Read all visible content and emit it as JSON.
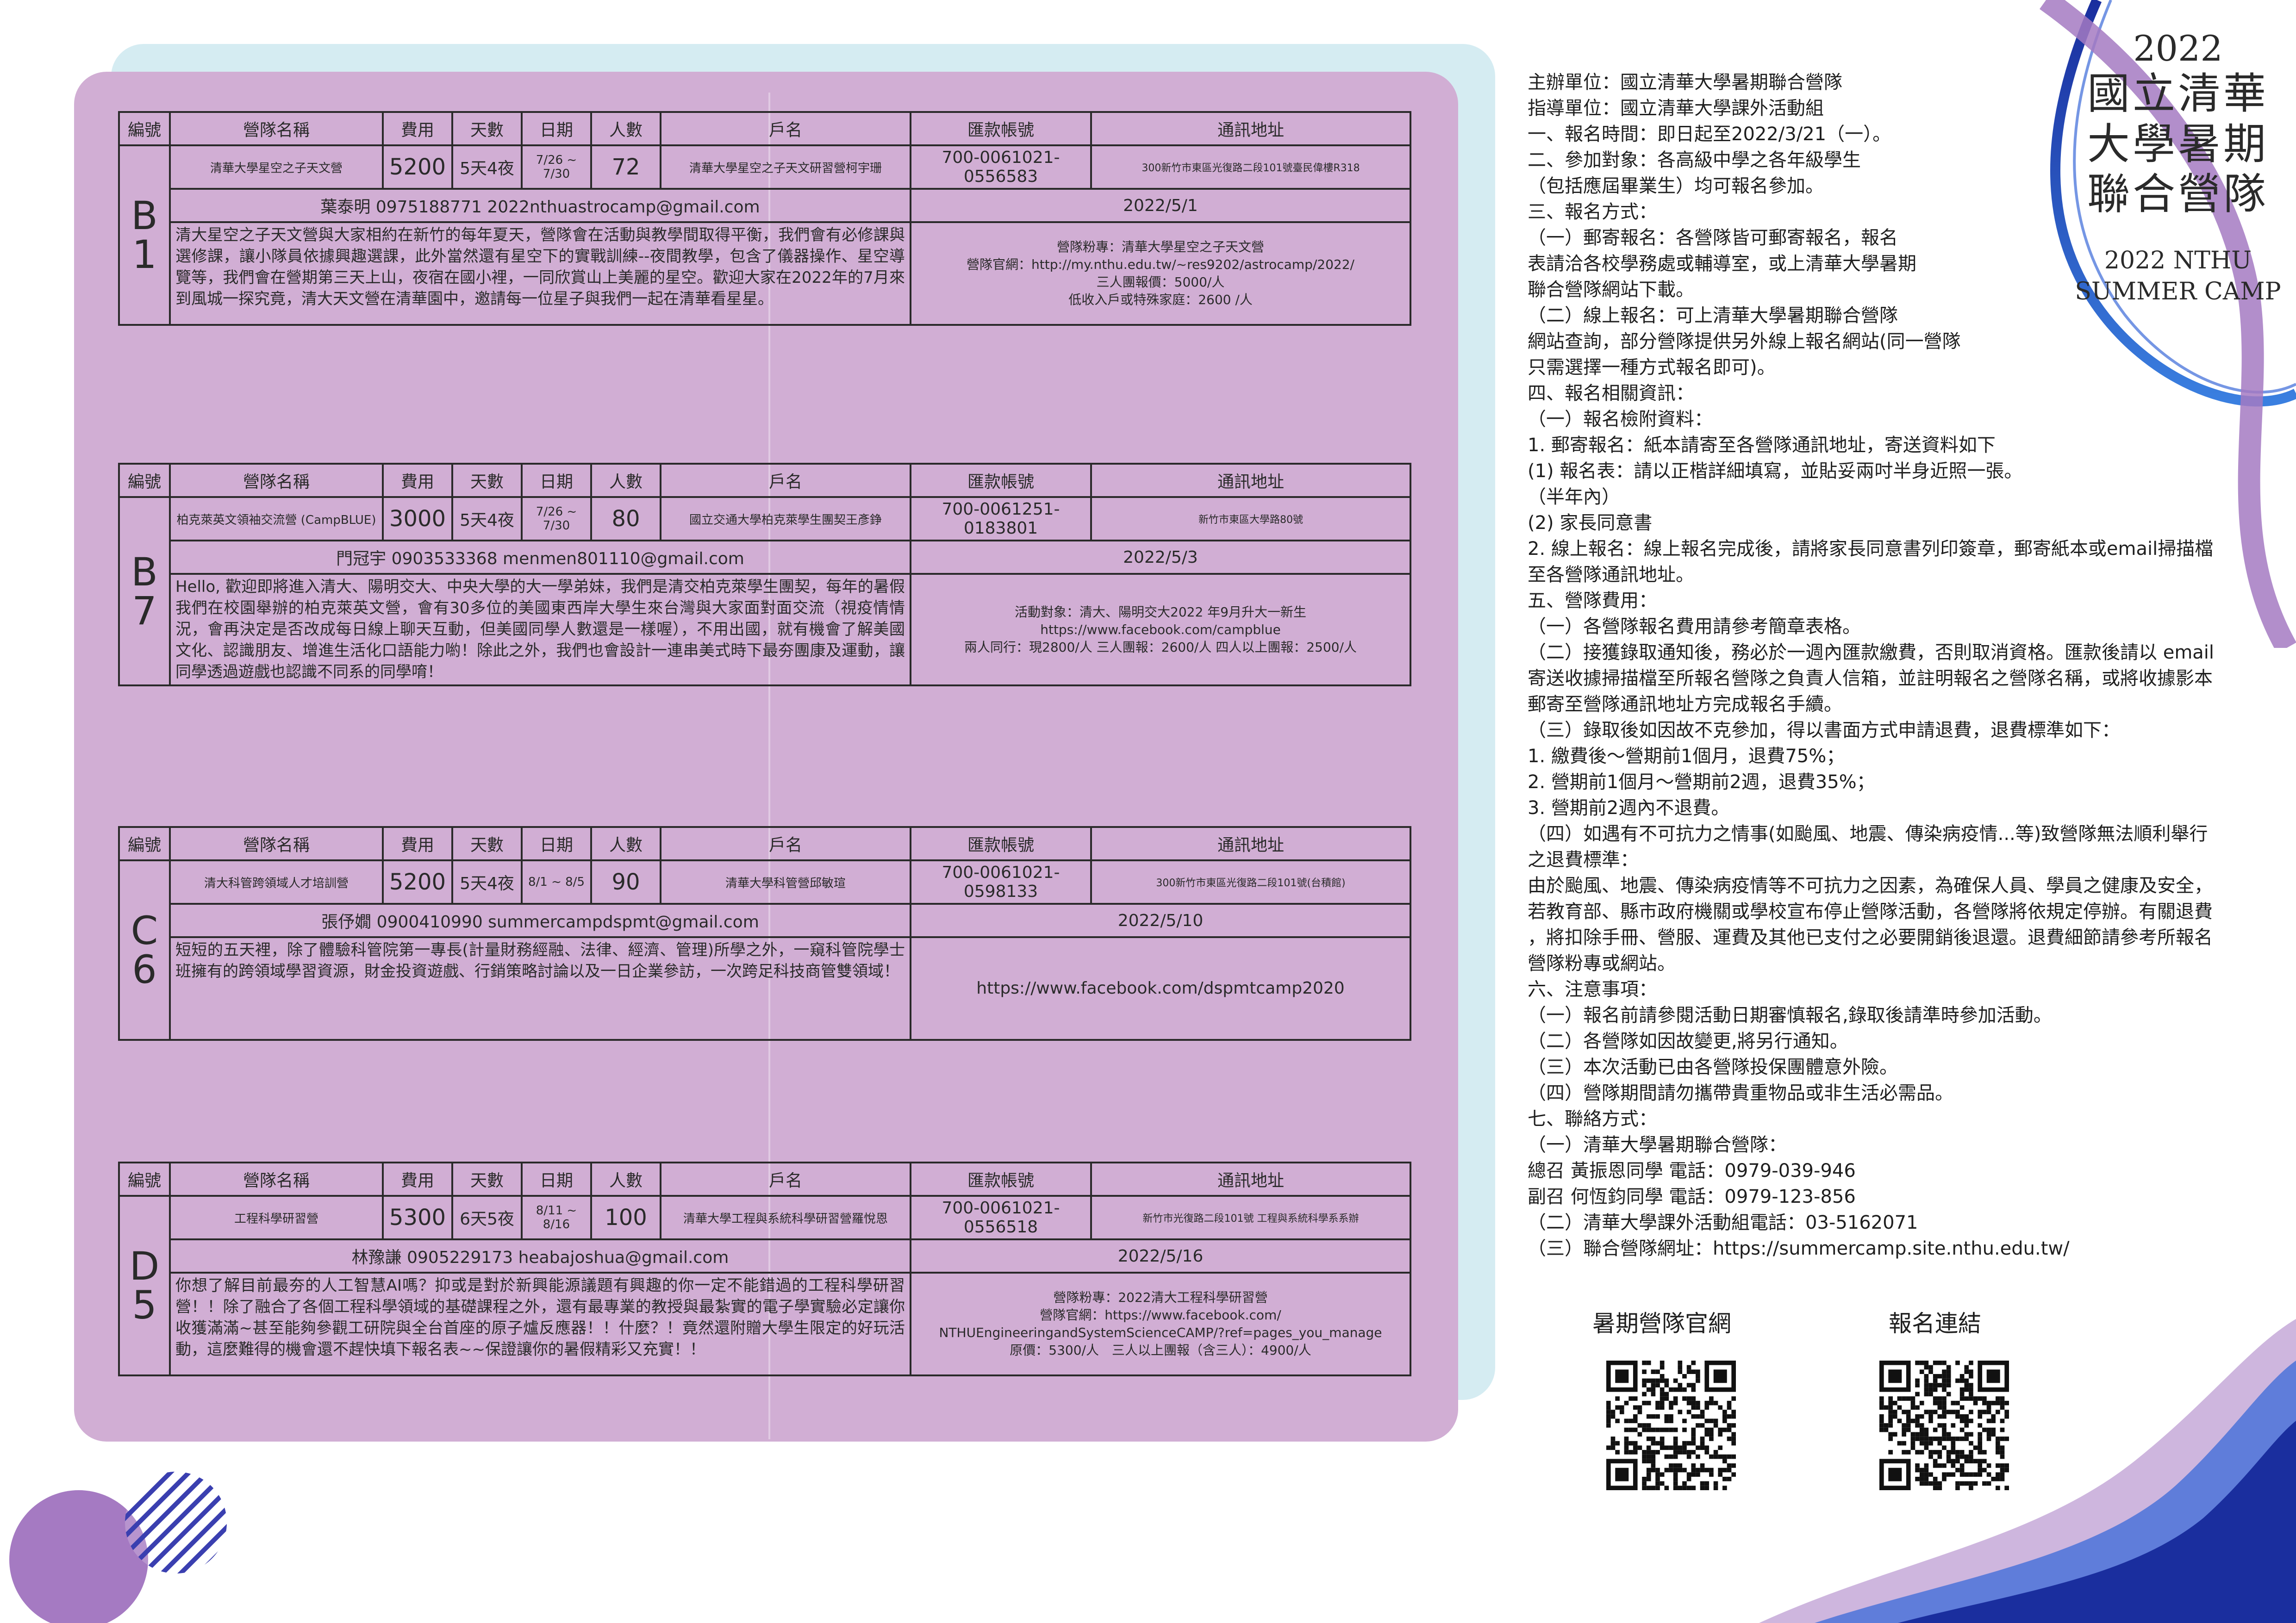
{
  "headers": {
    "id": "編號",
    "name": "營隊名稱",
    "fee": "費用",
    "days": "天數",
    "date": "日期",
    "people": "人數",
    "holder": "戶名",
    "account": "匯款帳號",
    "address": "通訊地址"
  },
  "camps": [
    {
      "id": "B\n1",
      "name": "清華大學星空之子天文營",
      "fee": "5200",
      "days": "5天4夜",
      "date": "7/26 ~ 7/30",
      "people": "72",
      "holder": "清華大學星空之子天文研習營柯宇珊",
      "account": "700-0061021-0556583",
      "address": "300新竹市東區光復路二段101號臺民偉樓R318",
      "contact": "葉泰明 0975188771 2022nthuastrocamp@gmail.com",
      "deadline": "2022/5/1",
      "description": "清大星空之子天文營與大家相約在新竹的每年夏天，營隊會在活動與教學間取得平衡，我們會有必修課與選修課，讓小隊員依據興趣選課，此外當然還有星空下的實戰訓練--夜間教學，包含了儀器操作、星空導覽等，我們會在營期第三天上山，夜宿在國小裡，一同欣賞山上美麗的星空。歡迎大家在2022年的7月來到風城一探究竟，清大天文營在清華園中，邀請每一位星子與我們一起在清華看星星。",
      "fans": [
        "營隊粉專：清華大學星空之子天文營",
        "營隊官網：http://my.nthu.edu.tw/~res9202/astrocamp/2022/",
        "三人團報價：5000/人",
        "低收入戶或特殊家庭：2600 /人"
      ]
    },
    {
      "id": "B\n7",
      "name": "柏克萊英文領袖交流營 (CampBLUE)",
      "fee": "3000",
      "days": "5天4夜",
      "date": "7/26 ~ 7/30",
      "people": "80",
      "holder": "國立交通大學柏克萊學生團契王彥錚",
      "account": "700-0061251-0183801",
      "address": "新竹市東區大學路80號",
      "contact": "門冠宇 0903533368 menmen801110@gmail.com",
      "deadline": "2022/5/3",
      "description": "Hello, 歡迎即將進入清大、陽明交大、中央大學的大一學弟妹，我們是清交柏克萊學生團契，每年的暑假我們在校園舉辦的柏克萊英文營，會有30多位的美國東西岸大學生來台灣與大家面對面交流（視疫情情況，會再決定是否改成每日線上聊天互動，但美國同學人數還是一樣喔），不用出國，就有機會了解美國文化、認識朋友、增進生活化口語能力喲！除此之外，我們也會設計一連串美式時下最夯團康及運動，讓同學透過遊戲也認識不同系的同學唷！",
      "fans": [
        "活動對象：清大、陽明交大2022 年9月升大一新生",
        "https://www.facebook.com/campblue",
        "兩人同行：現2800/人 三人團報：2600/人 四人以上團報：2500/人"
      ]
    },
    {
      "id": "C\n6",
      "name": "清大科管跨領域人才培訓營",
      "fee": "5200",
      "days": "5天4夜",
      "date": "8/1 ~ 8/5",
      "people": "90",
      "holder": "清華大學科管營邱敏瑄",
      "account": "700-0061021-0598133",
      "address": "300新竹市東區光復路二段101號(台積館)",
      "contact": "張伃嫺 0900410990 summercampdspmt@gmail.com",
      "deadline": "2022/5/10",
      "description": "短短的五天裡，除了體驗科管院第一專長(計量財務經融、法律、經濟、管理)所學之外，一窺科管院學士班擁有的跨領域學習資源，財金投資遊戲、行銷策略討論以及一日企業參訪，一次跨足科技商管雙領域！",
      "fans": [
        "https://www.facebook.com/dspmtcamp2020"
      ]
    },
    {
      "id": "D\n5",
      "name": "工程科學研習營",
      "fee": "5300",
      "days": "6天5夜",
      "date": "8/11 ~ 8/16",
      "people": "100",
      "holder": "清華大學工程與系統科學研習營羅悅恩",
      "account": "700-0061021-0556518",
      "address": "新竹市光復路二段101號 工程與系統科學系系辦",
      "contact": "林豫謙 0905229173 heabajoshua@gmail.com",
      "deadline": "2022/5/16",
      "description": "你想了解目前最夯的人工智慧AI嗎？抑或是對於新興能源議題有興趣的你一定不能錯過的工程科學研習營！！除了融合了各個工程科學領域的基礎課程之外，還有最專業的教授與最紮實的電子學實驗必定讓你收獲滿滿~甚至能夠參觀工研院與全台首座的原子爐反應器！！什麼？！竟然還附贈大學生限定的好玩活動，這麼難得的機會還不趕快填下報名表~~保證讓你的暑假精彩又充實！！",
      "fans": [
        "營隊粉專：2022清大工程科學研習營",
        "營隊官網：https://www.facebook.com/",
        "NTHUEngineeringandSystemScienceCAMP/?ref=pages_you_manage",
        "原價：5300/人　三人以上團報（含三人）：4900/人"
      ]
    }
  ],
  "title": {
    "year": "2022",
    "zh_lines": [
      "國立清華",
      "大學暑期",
      "聯合營隊"
    ],
    "en_lines": [
      "2022 NTHU",
      "SUMMER CAMP"
    ]
  },
  "info_lines": [
    "主辦單位：國立清華大學暑期聯合營隊",
    "指導單位：國立清華大學課外活動組",
    "一、報名時間：即日起至2022/3/21（一）。",
    "二、參加對象：各高級中學之各年級學生",
    "（包括應屆畢業生）均可報名參加。",
    "三、報名方式：",
    "（一）郵寄報名：各營隊皆可郵寄報名，報名",
    "表請洽各校學務處或輔導室，或上清華大學暑期",
    "聯合營隊網站下載。",
    "（二）線上報名：可上清華大學暑期聯合營隊",
    "網站查詢，部分營隊提供另外線上報名網站(同一營隊",
    "只需選擇一種方式報名即可)。",
    "四、報名相關資訊：",
    "（一）報名檢附資料：",
    "1. 郵寄報名：紙本請寄至各營隊通訊地址，寄送資料如下",
    "(1) 報名表：請以正楷詳細填寫，並貼妥兩吋半身近照一張。",
    "（半年內）",
    "(2) 家長同意書",
    "2. 線上報名：線上報名完成後，請將家長同意書列印簽章，郵寄紙本或email掃描檔",
    "至各營隊通訊地址。",
    "五、營隊費用：",
    "（一）各營隊報名費用請參考簡章表格。",
    "（二）接獲錄取通知後，務必於一週內匯款繳費，否則取消資格。匯款後請以 email",
    " 寄送收據掃描檔至所報名營隊之負責人信箱，並註明報名之營隊名稱，或將收據影本",
    "郵寄至營隊通訊地址方完成報名手續。",
    "（三）錄取後如因故不克參加，得以書面方式申請退費，退費標準如下：",
    "1. 繳費後～營期前1個月，退費75%；",
    "2. 營期前1個月～營期前2週，退費35%；",
    "3. 營期前2週內不退費。",
    "（四）如遇有不可抗力之情事(如颱風、地震、傳染病疫情...等)致營隊無法順利舉行",
    "之退費標準：",
    "由於颱風、地震、傳染病疫情等不可抗力之因素，為確保人員、學員之健康及安全，",
    "若教育部、縣市政府機關或學校宣布停止營隊活動，各營隊將依規定停辦。有關退費",
    "，將扣除手冊、營服、運費及其他已支付之必要開銷後退還。退費細節請參考所報名",
    "營隊粉專或網站。",
    "六、注意事項：",
    "（一）報名前請參閱活動日期審慎報名,錄取後請準時參加活動。",
    "（二）各營隊如因故變更,將另行通知。",
    "（三）本次活動已由各營隊投保團體意外險。",
    "（四）營隊期間請勿攜帶貴重物品或非生活必需品。",
    "七、聯絡方式：",
    "（一）清華大學暑期聯合營隊：",
    "總召 黃振恩同學 電話：0979-039-946",
    "副召 何恆鈞同學 電話：0979-123-856",
    "（二）清華大學課外活動組電話：03-5162071",
    "（三）聯合營隊網址：https://summercamp.site.nthu.edu.tw/"
  ],
  "qr": {
    "official_label": "暑期營隊官網",
    "signup_label": "報名連結"
  },
  "colors": {
    "panel": "#d1aed4",
    "panel_back": "#d5ecf2",
    "accent_purple": "#a57ac2",
    "accent_blue": "#1e3cb8"
  }
}
